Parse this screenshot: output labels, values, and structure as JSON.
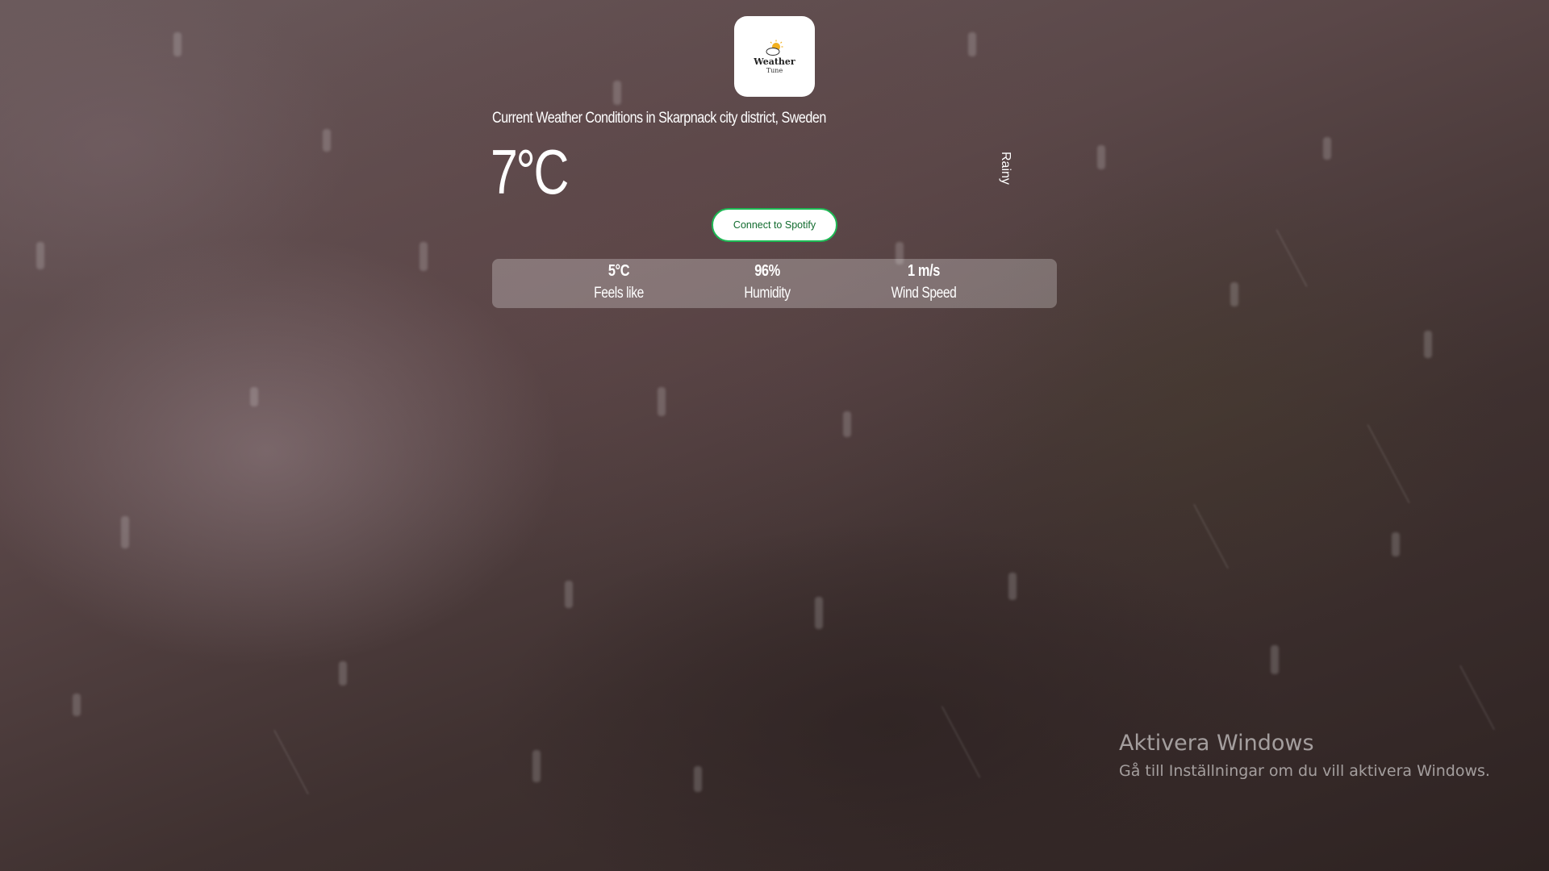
{
  "logo": {
    "title": "Weather",
    "subtitle": "Tune"
  },
  "weather": {
    "location_heading": "Current Weather Conditions in Skarpnack city district, Sweden",
    "temperature": "7°C",
    "condition": "Rainy"
  },
  "spotify": {
    "button_label": "Connect to Spotify"
  },
  "stats": {
    "feels_like": {
      "value": "5°C",
      "label": "Feels like"
    },
    "humidity": {
      "value": "96%",
      "label": "Humidity"
    },
    "wind_speed": {
      "value": "1 m/s",
      "label": "Wind Speed"
    }
  },
  "watermark": {
    "title": "Aktivera Windows",
    "subtitle": "Gå till Inställningar om du vill aktivera Windows."
  },
  "colors": {
    "spotify_border": "#1db954",
    "spotify_text": "#116b2e",
    "background": "#4a3a3b"
  }
}
